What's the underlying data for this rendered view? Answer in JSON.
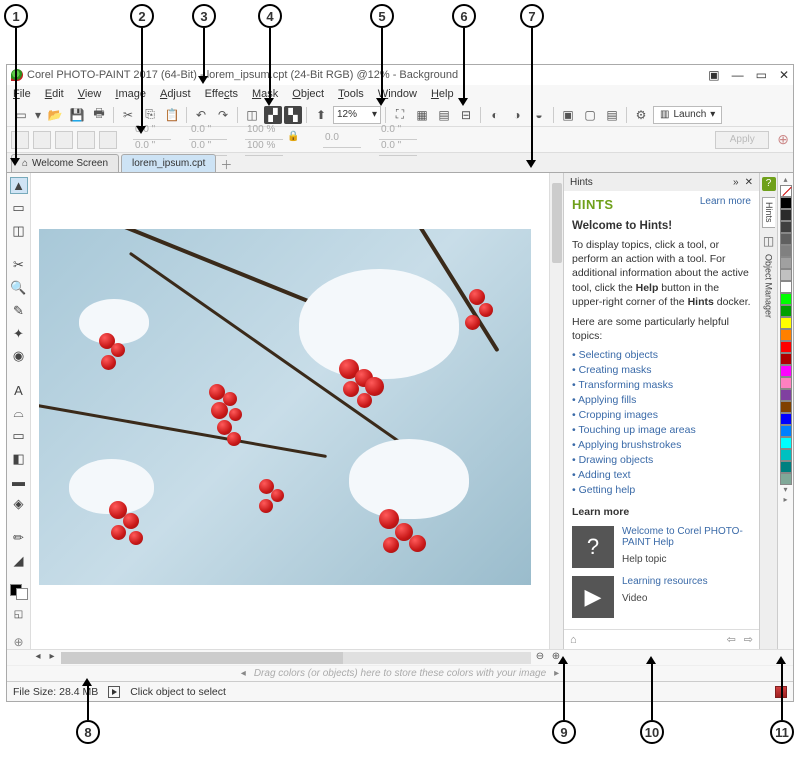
{
  "callouts": [
    "1",
    "2",
    "3",
    "4",
    "5",
    "6",
    "7",
    "8",
    "9",
    "10",
    "11"
  ],
  "titlebar": {
    "title": "Corel PHOTO-PAINT 2017 (64-Bit) - lorem_ipsum.cpt (24-Bit RGB) @12% - Background"
  },
  "menubar": {
    "file": "File",
    "edit": "Edit",
    "view": "View",
    "image": "Image",
    "adjust": "Adjust",
    "effects": "Effects",
    "mask": "Mask",
    "object": "Object",
    "tools": "Tools",
    "window": "Window",
    "help": "Help"
  },
  "toolbar": {
    "zoom": "12%",
    "launch": "Launch"
  },
  "propbar": {
    "x": "0.0 \"",
    "y": "0.0 \"",
    "w": "0.0 \"",
    "h": "0.0 \"",
    "sx": "100 %",
    "sy": "100 %",
    "rot": "0.0",
    "tx": "0.0 \"",
    "ty": "0.0 \"",
    "apply": "Apply"
  },
  "tabs": {
    "welcome": "Welcome Screen",
    "doc": "lorem_ipsum.cpt"
  },
  "hints": {
    "docker_title": "Hints",
    "title": "HINTS",
    "learn_more": "Learn more",
    "welcome": "Welcome to Hints!",
    "body1": "To display topics, click a tool, or perform an action with a tool. For additional information about the active tool, click the ",
    "body_help": "Help",
    "body2": " button in the upper-right corner of the ",
    "body_hints": "Hints",
    "body3": " docker.",
    "intro2": "Here are some particularly helpful topics:",
    "topics": [
      "Selecting objects",
      "Creating masks",
      "Transforming masks",
      "Applying fills",
      "Cropping images",
      "Touching up image areas",
      "Applying brushstrokes",
      "Drawing objects",
      "Adding text",
      "Getting help"
    ],
    "learnmore_h": "Learn more",
    "res1_link": "Welcome to Corel PHOTO-PAINT Help",
    "res1_sub": "Help topic",
    "res2_link": "Learning resources",
    "res2_sub": "Video"
  },
  "docker_tabs": {
    "hints": "Hints",
    "objmgr": "Object Manager"
  },
  "palette": [
    "#000000",
    "#404040",
    "#606060",
    "#808080",
    "#a0a0a0",
    "#c0c0c0",
    "#ffffff",
    "#00ff00",
    "#00c000",
    "#ffff00",
    "#ff8000",
    "#ff0000",
    "#c00000",
    "#ff00ff",
    "#ff80ff",
    "#8040c0",
    "#804000",
    "#0000ff",
    "#0080ff",
    "#00ffff",
    "#00c0c0",
    "#008080",
    "#80a090"
  ],
  "dropzone": {
    "text": "Drag colors (or objects) here to store these colors with your image"
  },
  "status": {
    "filesize_label": "File Size:",
    "filesize": "28.4 MB",
    "hint": "Click object to select"
  }
}
